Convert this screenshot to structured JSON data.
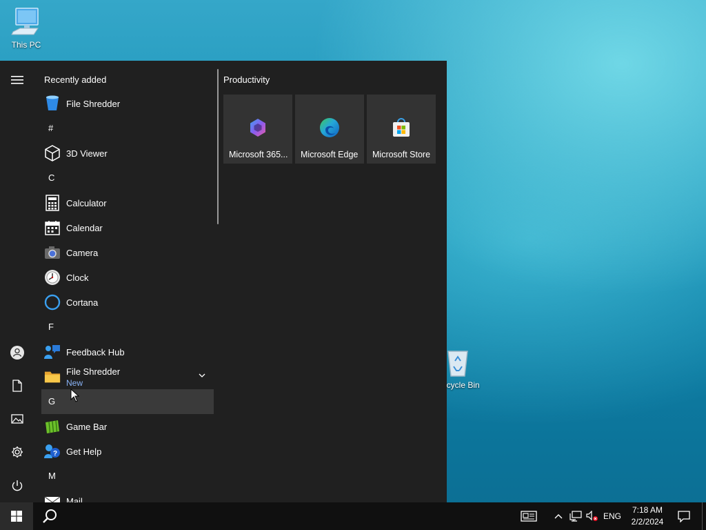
{
  "desktop": {
    "this_pc_label": "This PC",
    "recycle_bin_label": "Recycle Bin"
  },
  "start_menu": {
    "recently_added_title": "Recently added",
    "apps": [
      {
        "type": "app",
        "label": "File Shredder",
        "icon": "recycle-bin-blue-icon"
      },
      {
        "type": "letter",
        "label": "#"
      },
      {
        "type": "app",
        "label": "3D Viewer",
        "icon": "cube-icon"
      },
      {
        "type": "letter",
        "label": "C"
      },
      {
        "type": "app",
        "label": "Calculator",
        "icon": "calculator-icon"
      },
      {
        "type": "app",
        "label": "Calendar",
        "icon": "calendar-icon"
      },
      {
        "type": "app",
        "label": "Camera",
        "icon": "camera-icon"
      },
      {
        "type": "app",
        "label": "Clock",
        "icon": "clock-icon"
      },
      {
        "type": "app",
        "label": "Cortana",
        "icon": "cortana-ring-icon"
      },
      {
        "type": "letter",
        "label": "F"
      },
      {
        "type": "app",
        "label": "Feedback Hub",
        "icon": "feedback-icon"
      },
      {
        "type": "folder",
        "label": "File Shredder",
        "sublabel": "New",
        "icon": "folder-icon"
      },
      {
        "type": "letter",
        "label": "G"
      },
      {
        "type": "app",
        "label": "Game Bar",
        "icon": "game-bar-icon"
      },
      {
        "type": "app",
        "label": "Get Help",
        "icon": "help-icon"
      },
      {
        "type": "letter",
        "label": "M"
      },
      {
        "type": "app",
        "label": "Mail",
        "icon": "mail-icon"
      }
    ],
    "tile_group_title": "Productivity",
    "tiles": [
      {
        "label": "Microsoft 365...",
        "icon": "microsoft-365-icon"
      },
      {
        "label": "Microsoft Edge",
        "icon": "edge-icon"
      },
      {
        "label": "Microsoft Store",
        "icon": "store-icon"
      }
    ]
  },
  "taskbar": {
    "language": "ENG",
    "time": "7:18 AM",
    "date": "2/2/2024"
  },
  "colors": {
    "menu_bg": "#202020",
    "tile_bg": "#333333",
    "taskbar_bg": "#101010",
    "new_badge": "#8ab4f8"
  }
}
